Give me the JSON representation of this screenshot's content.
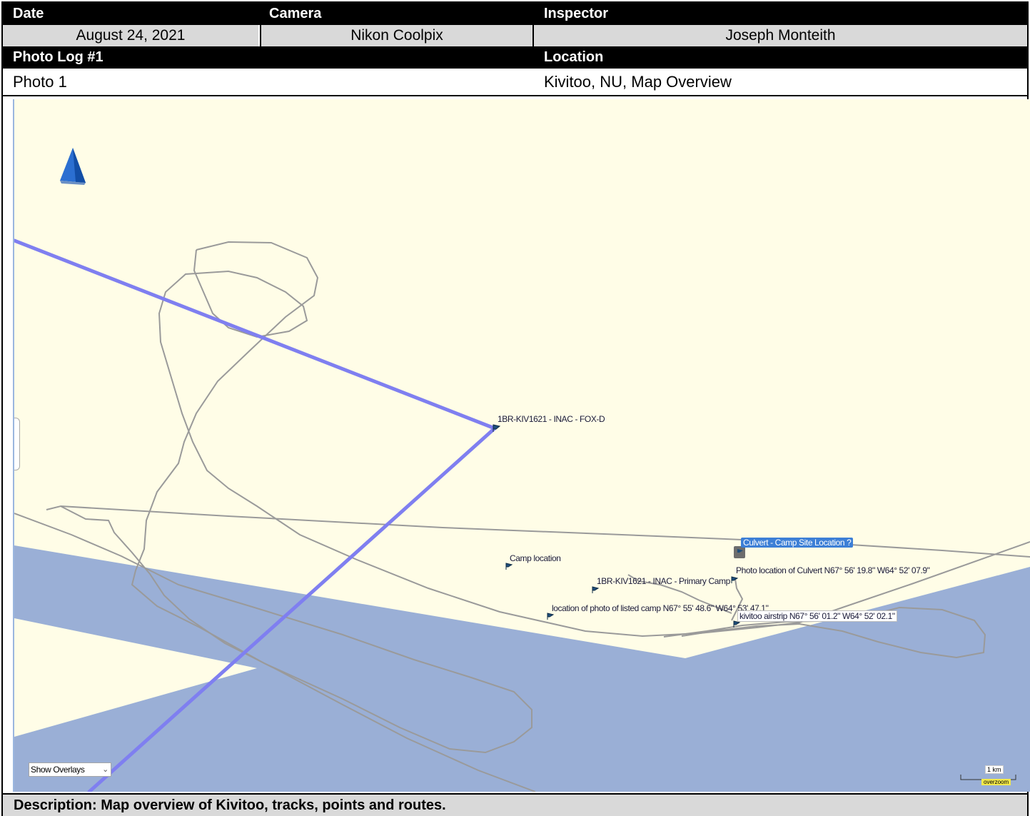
{
  "header": {
    "date_label": "Date",
    "camera_label": "Camera",
    "inspector_label": "Inspector",
    "date_value": "August 24, 2021",
    "camera_value": "Nikon Coolpix",
    "inspector_value": "Joseph Monteith",
    "photo_log_label": "Photo Log #1",
    "location_label": "Location",
    "photo_value": "Photo 1",
    "location_value": "Kivitoo, NU, Map Overview"
  },
  "map": {
    "waypoints": [
      {
        "label": "1BR-KIV1621 - INAC - FOX-D"
      },
      {
        "label": "Culvert - Camp Site Location ?"
      },
      {
        "label": "Camp location"
      },
      {
        "label": "Photo location of Culvert N67° 56' 19.8\" W64° 52' 07.9\""
      },
      {
        "label": "1BR-KIV1621 - INAC - Primary Camp"
      },
      {
        "label": "location of photo of listed camp N67° 55' 48.6\" W64° 53' 47.1\""
      },
      {
        "label": "kivitoo airstrip N67° 56' 01.2\" W64° 52' 02.1\""
      }
    ],
    "overlay_select": "Show Overlays",
    "scale_label": "1 km",
    "zoom_badge": "overzoom",
    "colors": {
      "land": "#fffde7",
      "water": "#9aafd6",
      "route": "#7f7ff0",
      "track": "#9a9a9a",
      "flag": "#1f4e7a"
    }
  },
  "description": "Description: Map overview of Kivitoo, tracks, points and routes."
}
